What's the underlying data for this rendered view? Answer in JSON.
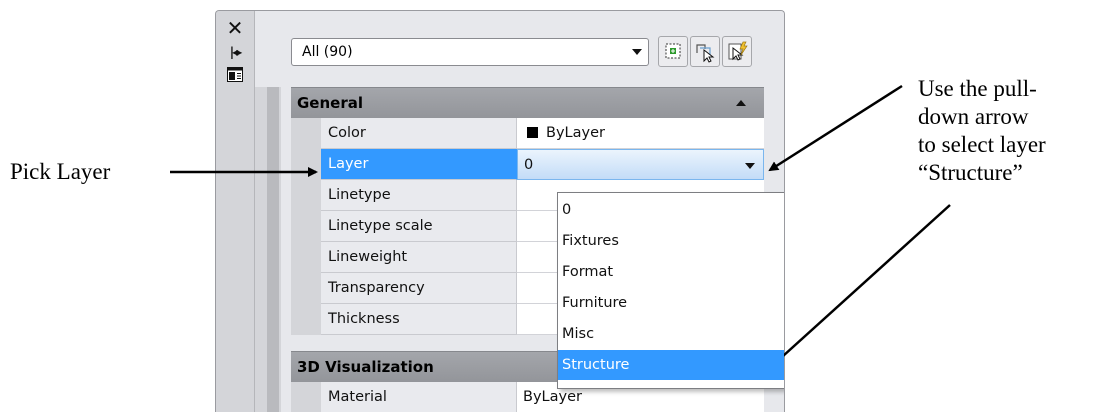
{
  "annotations": {
    "left": "Pick Layer",
    "right_lines": [
      "Use the pull-",
      "down arrow",
      "to select layer",
      "“Structure”"
    ]
  },
  "palette": {
    "titlebar_icons": [
      "close-icon",
      "auto-hide-icon",
      "properties-icon"
    ],
    "selection_filter": {
      "value": "All (90)"
    },
    "toolbar_buttons": [
      "toggle-pickadd-icon",
      "select-objects-icon",
      "quick-select-icon"
    ],
    "sections": [
      {
        "title": "General",
        "rows": [
          {
            "name": "Color",
            "value": "ByLayer"
          },
          {
            "name": "Layer",
            "value": "0"
          },
          {
            "name": "Linetype",
            "value": ""
          },
          {
            "name": "Linetype scale",
            "value": ""
          },
          {
            "name": "Lineweight",
            "value": ""
          },
          {
            "name": "Transparency",
            "value": ""
          },
          {
            "name": "Thickness",
            "value": ""
          }
        ]
      },
      {
        "title": "3D Visualization",
        "rows": [
          {
            "name": "Material",
            "value": "ByLayer"
          }
        ]
      }
    ],
    "layer_dropdown": {
      "options": [
        "0",
        "Fixtures",
        "Format",
        "Furniture",
        "Misc",
        "Structure"
      ],
      "highlighted": "Structure"
    }
  },
  "colors": {
    "selection_blue": "#3399ff",
    "header_gray": "#9b9da2",
    "panel_gray": "#d4d5d9"
  }
}
